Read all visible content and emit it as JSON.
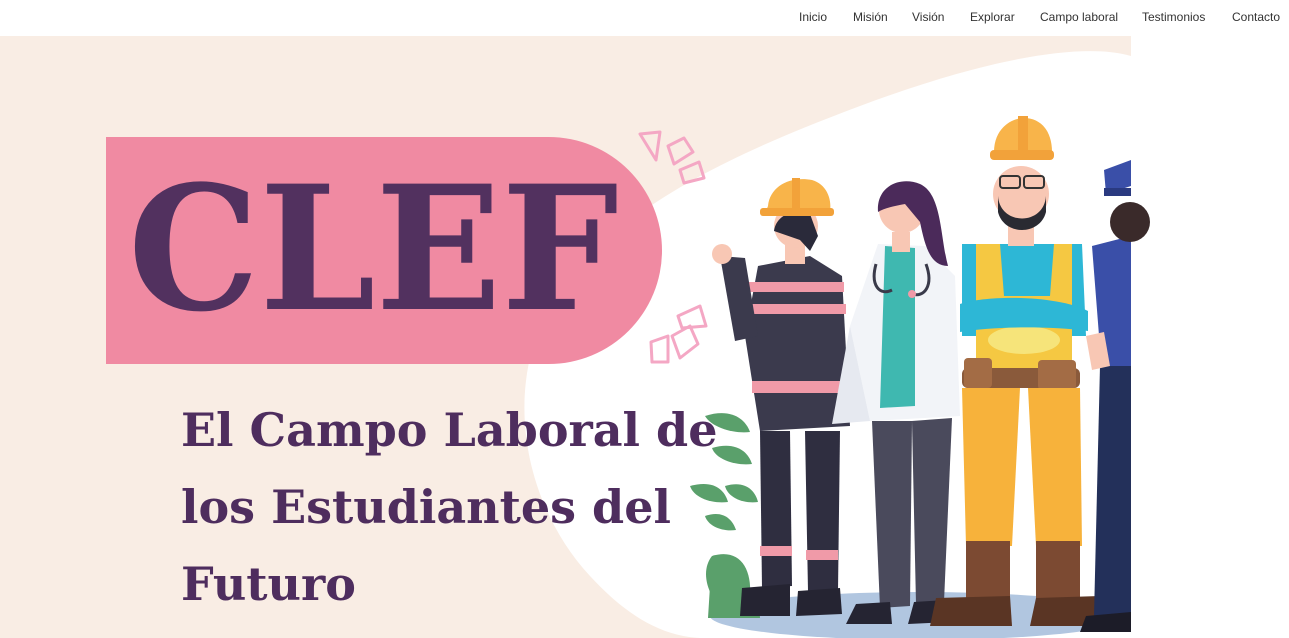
{
  "nav": {
    "items": [
      {
        "label": "Inicio"
      },
      {
        "label": "Misión"
      },
      {
        "label": "Visión"
      },
      {
        "label": "Explorar"
      },
      {
        "label": "Campo laboral"
      },
      {
        "label": "Testimonios"
      },
      {
        "label": "Contacto"
      }
    ]
  },
  "hero": {
    "brand": "CLEF",
    "subtitle": "El Campo Laboral de los Estudiantes del Futuro",
    "illustration_icon": "workers-illustration-icon"
  },
  "colors": {
    "background": "#f9ede4",
    "brand_pill": "#f08aa2",
    "brand_text": "#52315f",
    "subtitle_text": "#4e2d5e",
    "accent_pink": "#f4a7c4"
  }
}
